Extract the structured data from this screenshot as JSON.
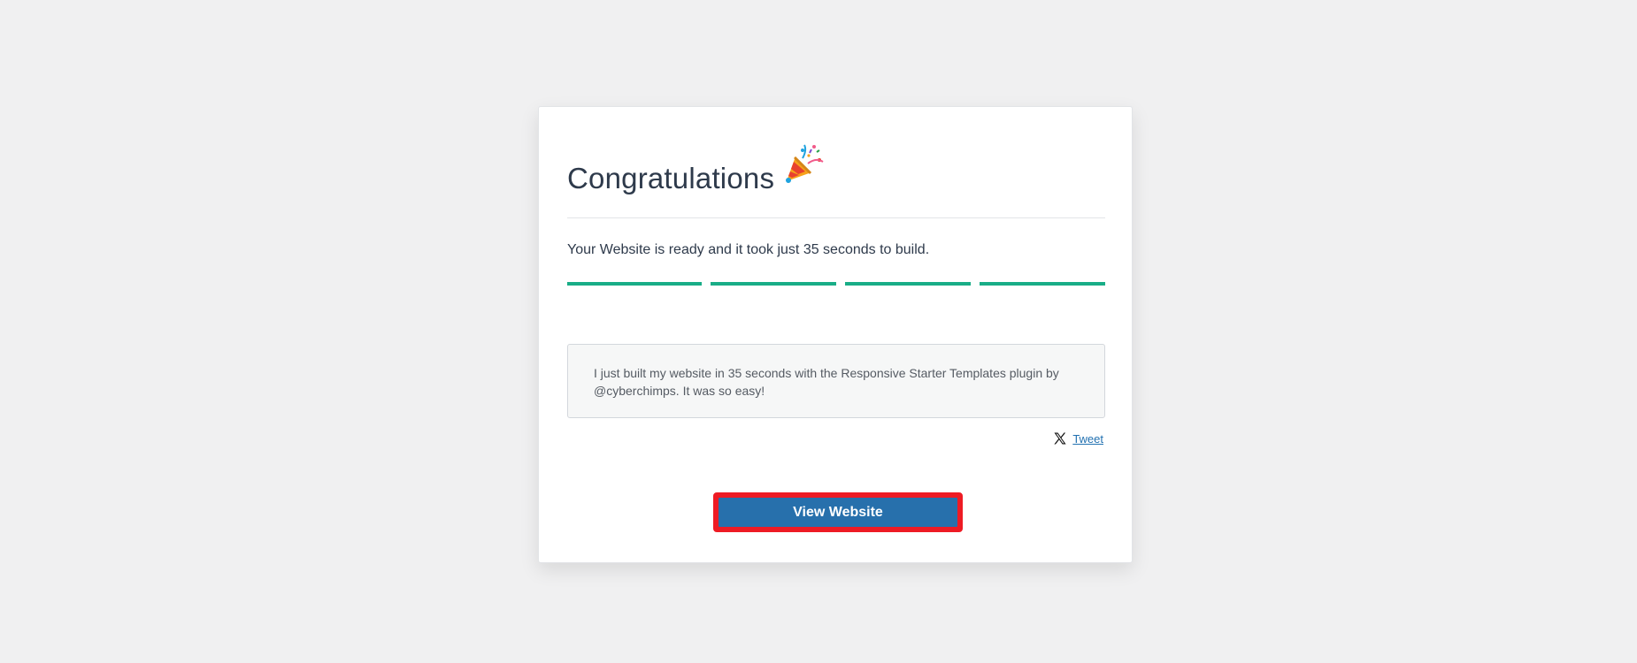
{
  "card": {
    "title": "Congratulations",
    "title_icon": "party-popper-icon",
    "ready_message": "Your Website is ready and it took just 35 seconds to build.",
    "progress": {
      "segments_total": 4,
      "segments_complete": 4,
      "color": "#19ad87"
    },
    "share_text": "I just built my website in 35 seconds with the Responsive Starter Templates plugin by @cyberchimps. It was so easy!",
    "tweet": {
      "icon": "x-logo-icon",
      "label": "Tweet"
    },
    "view_button_label": "View Website"
  },
  "colors": {
    "background": "#f0f0f1",
    "button": "#2770ac",
    "button_highlight": "#ee1b24",
    "link": "#2271b1"
  }
}
